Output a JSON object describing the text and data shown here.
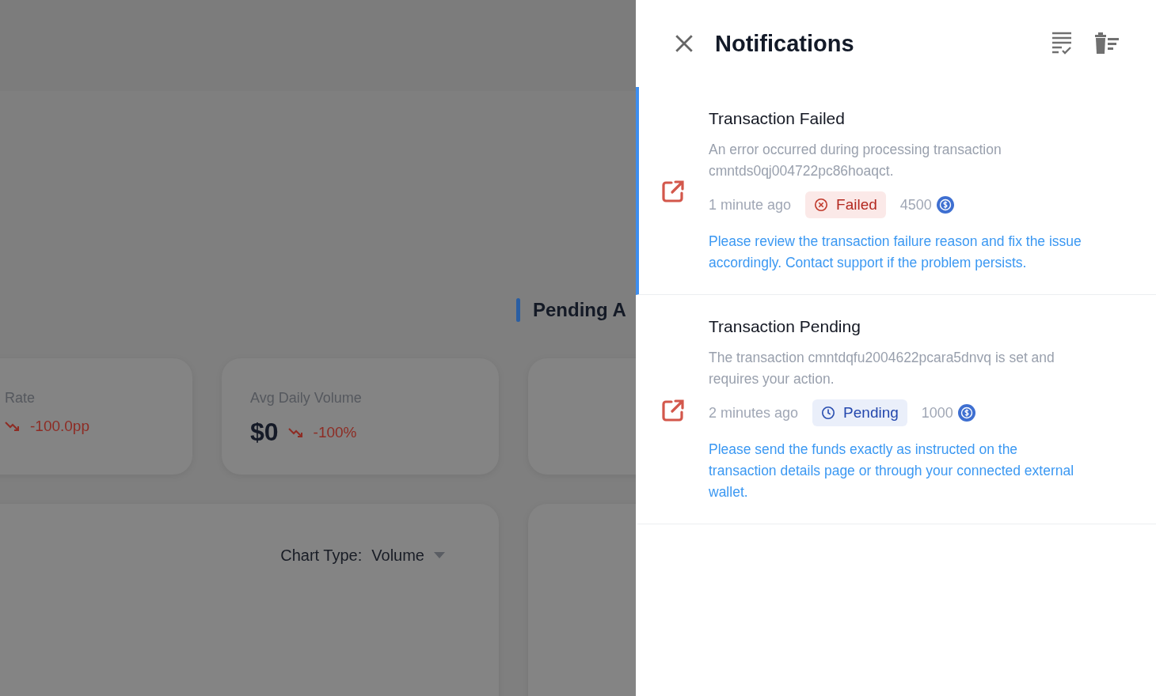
{
  "background": {
    "section_title": "Pending A",
    "stats": [
      {
        "label": "Rate",
        "change": "-100.0pp"
      },
      {
        "label": "Avg Daily Volume",
        "value": "$0",
        "change": "-100%"
      }
    ],
    "chart": {
      "label": "Chart Type:",
      "value": "Volume"
    }
  },
  "drawer": {
    "title": "Notifications",
    "notifications": [
      {
        "title": "Transaction Failed",
        "description": "An error occurred during processing transaction cmntds0qj004722pc86hoaqct.",
        "time": "1 minute ago",
        "status": {
          "kind": "failed",
          "label": "Failed"
        },
        "amount": "4500",
        "message": "Please review the transaction failure reason and fix the issue accordingly. Contact support if the problem persists.",
        "selected": true
      },
      {
        "title": "Transaction Pending",
        "description": "The transaction cmntdqfu2004622pcara5dnvq is set and requires your action.",
        "time": "2 minutes ago",
        "status": {
          "kind": "pending",
          "label": "Pending"
        },
        "amount": "1000",
        "message": "Please send the funds exactly as instructed on the transaction details page or through your connected external wallet.",
        "selected": false
      }
    ]
  }
}
